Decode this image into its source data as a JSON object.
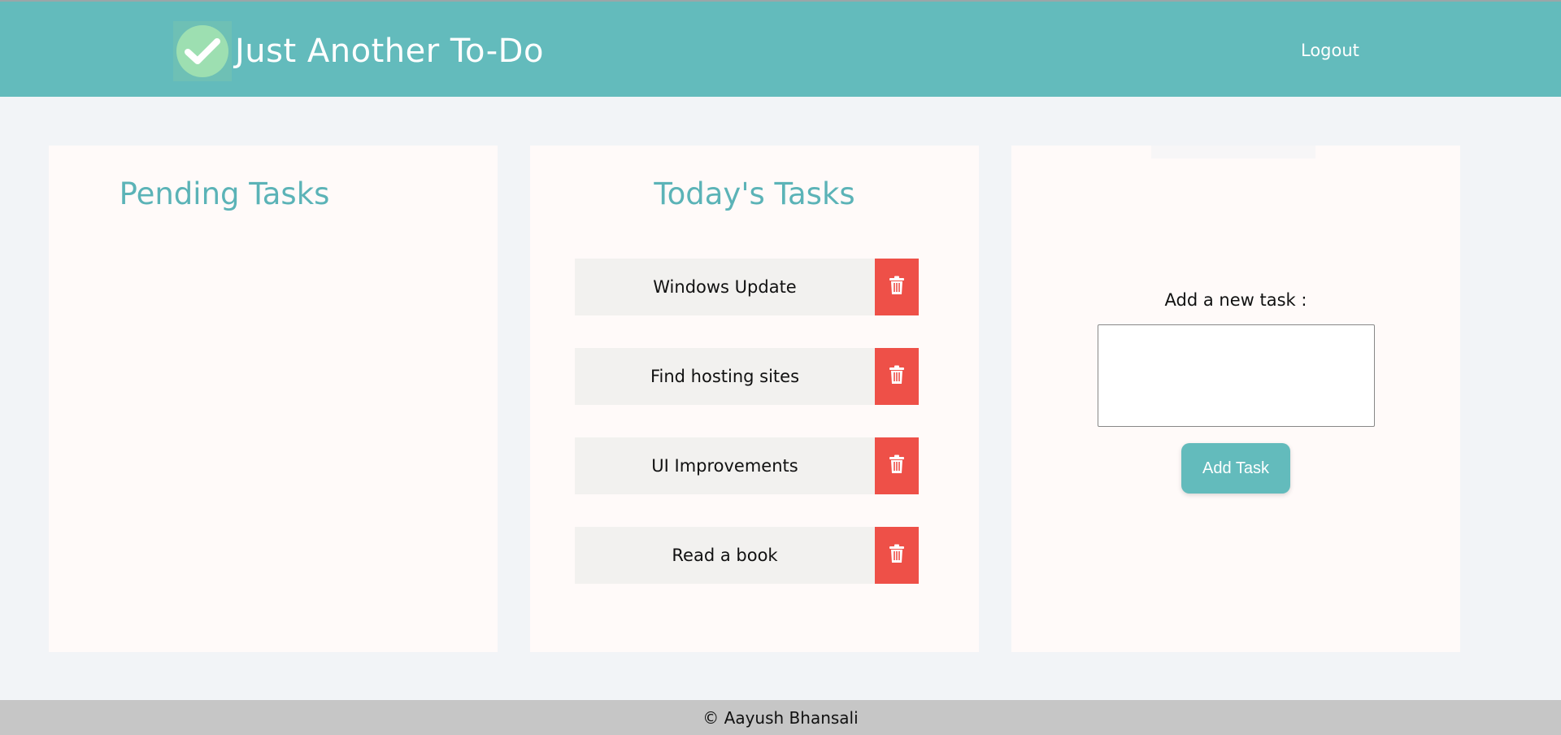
{
  "header": {
    "app_title": "Just Another To-Do",
    "logout_label": "Logout"
  },
  "pending": {
    "title": "Pending Tasks"
  },
  "today": {
    "title": "Today's Tasks",
    "tasks": [
      {
        "label": "Windows Update"
      },
      {
        "label": "Find hosting sites"
      },
      {
        "label": "UI Improvements"
      },
      {
        "label": "Read a book"
      }
    ]
  },
  "add_task": {
    "label": "Add a new task :",
    "input_value": "",
    "button_label": "Add Task"
  },
  "footer": {
    "text": "© Aayush Bhansali"
  },
  "icons": {
    "logo": "check-icon",
    "delete": "trash-icon"
  },
  "colors": {
    "primary": "#63bbbc",
    "danger": "#ee5048",
    "title": "#5bb3b7",
    "card": "#fffaf9",
    "background": "#f2f4f7",
    "footer": "#c6c6c6"
  }
}
